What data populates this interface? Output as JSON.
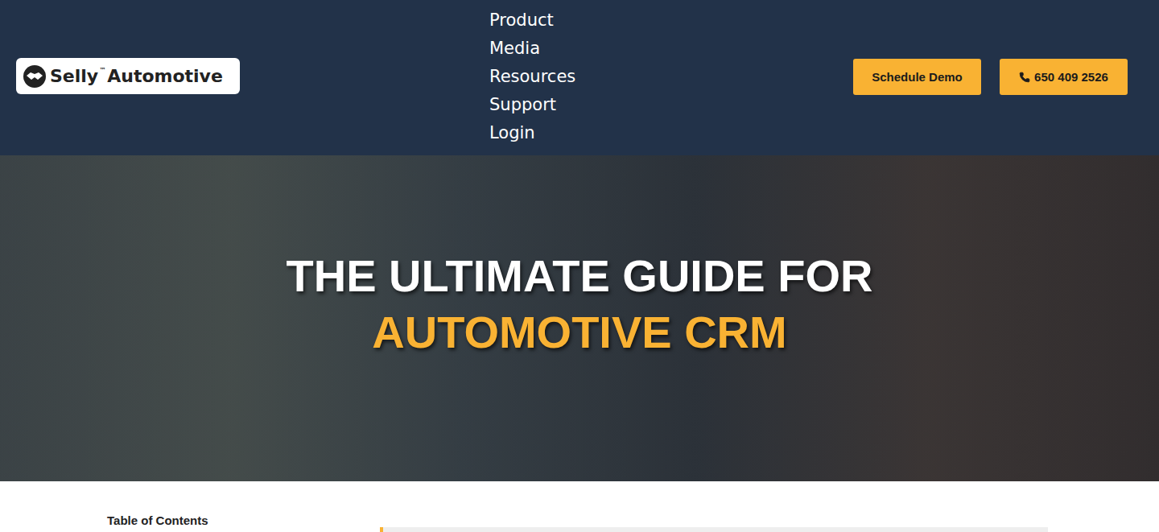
{
  "logo": {
    "name": "Selly",
    "mark": "™",
    "suffix": "Automotive"
  },
  "nav": [
    {
      "label": "Product"
    },
    {
      "label": "Media"
    },
    {
      "label": "Resources"
    },
    {
      "label": "Support"
    },
    {
      "label": "Login"
    }
  ],
  "buttons": [
    {
      "label": "Schedule Demo",
      "kind": "text"
    },
    {
      "label": "650 409 2526",
      "kind": "phone"
    }
  ],
  "hero": {
    "line1": "THE ULTIMATE GUIDE FOR",
    "line2": "AUTOMOTIVE CRM"
  },
  "toc": {
    "title": "Table of Contents"
  }
}
